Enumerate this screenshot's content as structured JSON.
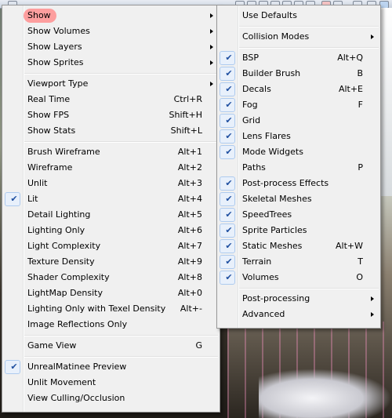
{
  "main_menu": {
    "items": [
      {
        "type": "item",
        "label": "Show",
        "shortcut": "",
        "submenu": true,
        "checked": false,
        "highlighted": true
      },
      {
        "type": "item",
        "label": "Show Volumes",
        "shortcut": "",
        "submenu": true,
        "checked": false
      },
      {
        "type": "item",
        "label": "Show Layers",
        "shortcut": "",
        "submenu": true,
        "checked": false
      },
      {
        "type": "item",
        "label": "Show Sprites",
        "shortcut": "",
        "submenu": true,
        "checked": false
      },
      {
        "type": "separator"
      },
      {
        "type": "item",
        "label": "Viewport Type",
        "shortcut": "",
        "submenu": true,
        "checked": false
      },
      {
        "type": "item",
        "label": "Real Time",
        "shortcut": "Ctrl+R",
        "submenu": false,
        "checked": false
      },
      {
        "type": "item",
        "label": "Show FPS",
        "shortcut": "Shift+H",
        "submenu": false,
        "checked": false
      },
      {
        "type": "item",
        "label": "Show Stats",
        "shortcut": "Shift+L",
        "submenu": false,
        "checked": false
      },
      {
        "type": "separator"
      },
      {
        "type": "item",
        "label": "Brush Wireframe",
        "shortcut": "Alt+1",
        "submenu": false,
        "checked": false
      },
      {
        "type": "item",
        "label": "Wireframe",
        "shortcut": "Alt+2",
        "submenu": false,
        "checked": false
      },
      {
        "type": "item",
        "label": "Unlit",
        "shortcut": "Alt+3",
        "submenu": false,
        "checked": false
      },
      {
        "type": "item",
        "label": "Lit",
        "shortcut": "Alt+4",
        "submenu": false,
        "checked": true
      },
      {
        "type": "item",
        "label": "Detail Lighting",
        "shortcut": "Alt+5",
        "submenu": false,
        "checked": false
      },
      {
        "type": "item",
        "label": "Lighting Only",
        "shortcut": "Alt+6",
        "submenu": false,
        "checked": false
      },
      {
        "type": "item",
        "label": "Light Complexity",
        "shortcut": "Alt+7",
        "submenu": false,
        "checked": false
      },
      {
        "type": "item",
        "label": "Texture Density",
        "shortcut": "Alt+9",
        "submenu": false,
        "checked": false
      },
      {
        "type": "item",
        "label": "Shader Complexity",
        "shortcut": "Alt+8",
        "submenu": false,
        "checked": false
      },
      {
        "type": "item",
        "label": "LightMap Density",
        "shortcut": "Alt+0",
        "submenu": false,
        "checked": false
      },
      {
        "type": "item",
        "label": "Lighting Only with Texel Density",
        "shortcut": "Alt+-",
        "submenu": false,
        "checked": false
      },
      {
        "type": "item",
        "label": "Image Reflections Only",
        "shortcut": "",
        "submenu": false,
        "checked": false
      },
      {
        "type": "separator"
      },
      {
        "type": "item",
        "label": "Game View",
        "shortcut": "G",
        "submenu": false,
        "checked": false
      },
      {
        "type": "separator"
      },
      {
        "type": "item",
        "label": "UnrealMatinee Preview",
        "shortcut": "",
        "submenu": false,
        "checked": true
      },
      {
        "type": "item",
        "label": "Unlit Movement",
        "shortcut": "",
        "submenu": false,
        "checked": false
      },
      {
        "type": "item",
        "label": "View Culling/Occlusion",
        "shortcut": "",
        "submenu": false,
        "checked": false
      }
    ]
  },
  "show_submenu": {
    "items": [
      {
        "type": "item",
        "label": "Use Defaults",
        "shortcut": "",
        "submenu": false,
        "checked": false
      },
      {
        "type": "separator"
      },
      {
        "type": "item",
        "label": "Collision Modes",
        "shortcut": "",
        "submenu": true,
        "checked": false
      },
      {
        "type": "separator"
      },
      {
        "type": "item",
        "label": "BSP",
        "shortcut": "Alt+Q",
        "submenu": false,
        "checked": true
      },
      {
        "type": "item",
        "label": "Builder Brush",
        "shortcut": "B",
        "submenu": false,
        "checked": true
      },
      {
        "type": "item",
        "label": "Decals",
        "shortcut": "Alt+E",
        "submenu": false,
        "checked": true
      },
      {
        "type": "item",
        "label": "Fog",
        "shortcut": "F",
        "submenu": false,
        "checked": true
      },
      {
        "type": "item",
        "label": "Grid",
        "shortcut": "",
        "submenu": false,
        "checked": true
      },
      {
        "type": "item",
        "label": "Lens Flares",
        "shortcut": "",
        "submenu": false,
        "checked": true
      },
      {
        "type": "item",
        "label": "Mode Widgets",
        "shortcut": "",
        "submenu": false,
        "checked": true
      },
      {
        "type": "item",
        "label": "Paths",
        "shortcut": "P",
        "submenu": false,
        "checked": false
      },
      {
        "type": "item",
        "label": "Post-process Effects",
        "shortcut": "",
        "submenu": false,
        "checked": true
      },
      {
        "type": "item",
        "label": "Skeletal Meshes",
        "shortcut": "",
        "submenu": false,
        "checked": true
      },
      {
        "type": "item",
        "label": "SpeedTrees",
        "shortcut": "",
        "submenu": false,
        "checked": true
      },
      {
        "type": "item",
        "label": "Sprite Particles",
        "shortcut": "",
        "submenu": false,
        "checked": true
      },
      {
        "type": "item",
        "label": "Static Meshes",
        "shortcut": "Alt+W",
        "submenu": false,
        "checked": true
      },
      {
        "type": "item",
        "label": "Terrain",
        "shortcut": "T",
        "submenu": false,
        "checked": true
      },
      {
        "type": "item",
        "label": "Volumes",
        "shortcut": "O",
        "submenu": false,
        "checked": true
      },
      {
        "type": "separator"
      },
      {
        "type": "item",
        "label": "Post-processing",
        "shortcut": "",
        "submenu": true,
        "checked": false
      },
      {
        "type": "item",
        "label": "Advanced",
        "shortcut": "",
        "submenu": true,
        "checked": false
      }
    ]
  },
  "icons": {
    "check": "checkmark-icon",
    "submenu": "submenu-arrow-icon"
  },
  "colors": {
    "menu_bg": "#f0f0f0",
    "check": "#1f4fa0",
    "highlight_oval": "#ff8f8f"
  }
}
